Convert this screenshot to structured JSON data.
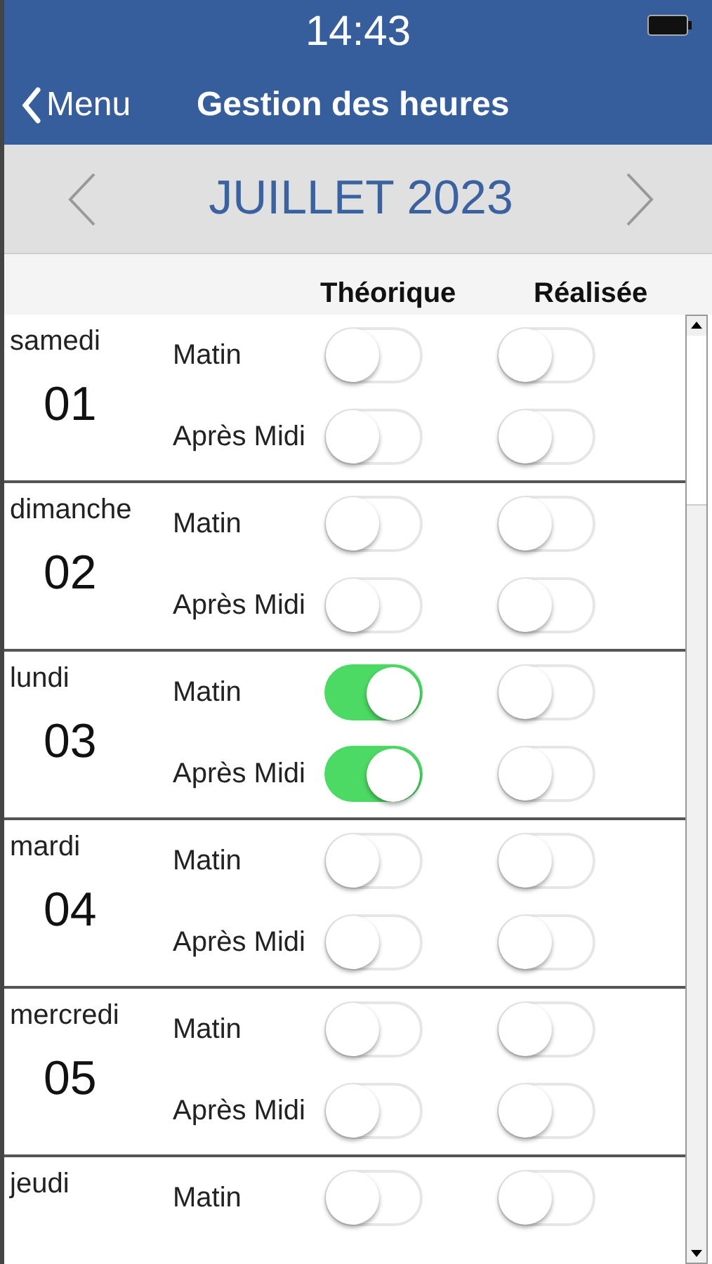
{
  "status_bar": {
    "time": "14:43"
  },
  "nav": {
    "back": "Menu",
    "title": "Gestion des heures"
  },
  "month": {
    "label": "JUILLET 2023"
  },
  "columns": [
    "Théorique",
    "Réalisée"
  ],
  "days": [
    {
      "name": "samedi",
      "number": "01",
      "slots": [
        {
          "label": "Matin",
          "theorique": false,
          "realisee": false
        },
        {
          "label": "Après Midi",
          "theorique": false,
          "realisee": false
        }
      ]
    },
    {
      "name": "dimanche",
      "number": "02",
      "slots": [
        {
          "label": "Matin",
          "theorique": false,
          "realisee": false
        },
        {
          "label": "Après Midi",
          "theorique": false,
          "realisee": false
        }
      ]
    },
    {
      "name": "lundi",
      "number": "03",
      "slots": [
        {
          "label": "Matin",
          "theorique": true,
          "realisee": false
        },
        {
          "label": "Après Midi",
          "theorique": true,
          "realisee": false
        }
      ]
    },
    {
      "name": "mardi",
      "number": "04",
      "slots": [
        {
          "label": "Matin",
          "theorique": false,
          "realisee": false
        },
        {
          "label": "Après Midi",
          "theorique": false,
          "realisee": false
        }
      ]
    },
    {
      "name": "mercredi",
      "number": "05",
      "slots": [
        {
          "label": "Matin",
          "theorique": false,
          "realisee": false
        },
        {
          "label": "Après Midi",
          "theorique": false,
          "realisee": false
        }
      ]
    },
    {
      "name": "jeudi",
      "slots": [
        {
          "label": "Matin",
          "theorique": false,
          "realisee": false
        }
      ]
    }
  ]
}
